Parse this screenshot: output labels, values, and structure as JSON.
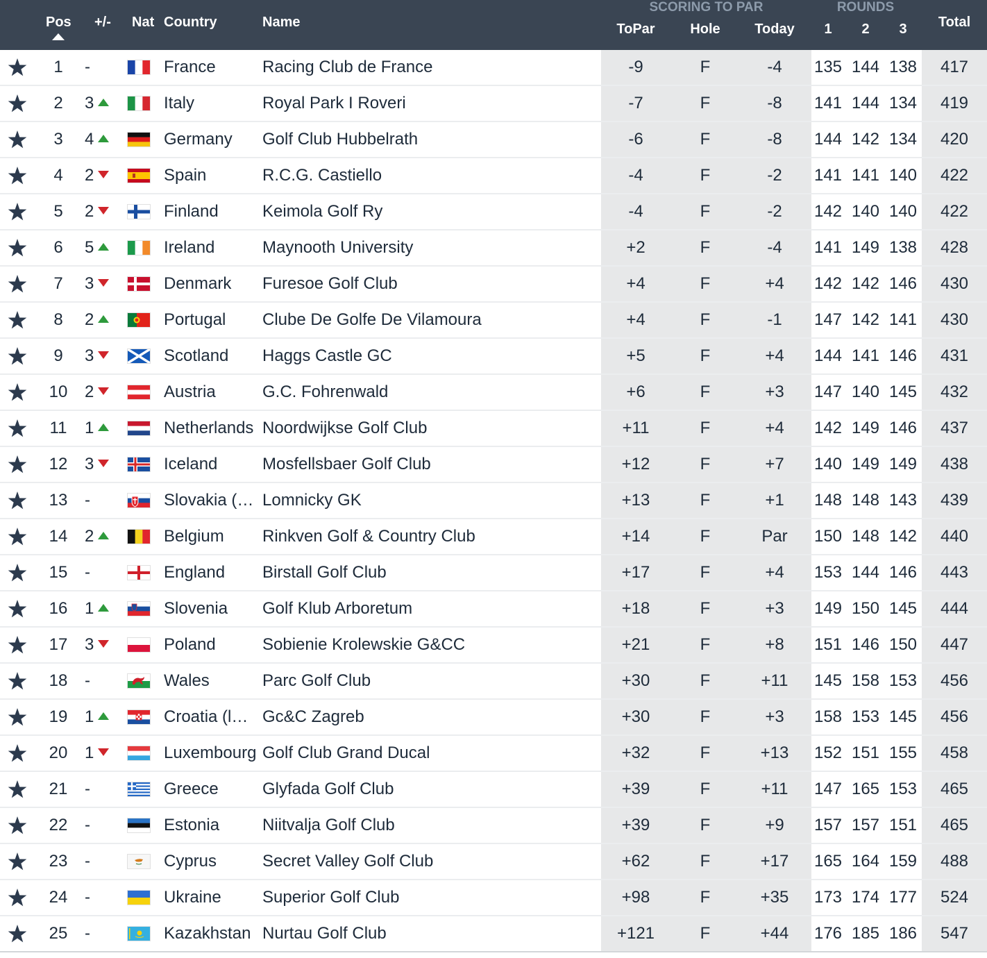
{
  "header": {
    "pos": "Pos",
    "change": "+/-",
    "nat": "Nat",
    "country": "Country",
    "name": "Name",
    "scoring_group": "SCORING TO PAR",
    "topar": "ToPar",
    "hole": "Hole",
    "today": "Today",
    "rounds_group": "ROUNDS",
    "r1": "1",
    "r2": "2",
    "r3": "3",
    "total": "Total"
  },
  "colors": {
    "header_bg": "#3a4553",
    "header_group_text": "#8d9bab",
    "shaded_column_bg": "#e7e8e9",
    "star": "#2c3a4d",
    "up": "#2e9a3c",
    "down": "#d0252b"
  },
  "icons": {
    "favorite": "star-icon",
    "move_up": "triangle-up-icon",
    "move_down": "triangle-down-icon",
    "sort": "sort-ascending-icon"
  },
  "rows": [
    {
      "pos": "1",
      "change": "-",
      "dir": "none",
      "flag": "france",
      "country": "France",
      "name": "Racing Club de France",
      "topar": "-9",
      "hole": "F",
      "today": "-4",
      "r1": "135",
      "r2": "144",
      "r3": "138",
      "total": "417"
    },
    {
      "pos": "2",
      "change": "3",
      "dir": "up",
      "flag": "italy",
      "country": "Italy",
      "name": "Royal Park I Roveri",
      "topar": "-7",
      "hole": "F",
      "today": "-8",
      "r1": "141",
      "r2": "144",
      "r3": "134",
      "total": "419"
    },
    {
      "pos": "3",
      "change": "4",
      "dir": "up",
      "flag": "germany",
      "country": "Germany",
      "name": "Golf Club Hubbelrath",
      "topar": "-6",
      "hole": "F",
      "today": "-8",
      "r1": "144",
      "r2": "142",
      "r3": "134",
      "total": "420"
    },
    {
      "pos": "4",
      "change": "2",
      "dir": "down",
      "flag": "spain",
      "country": "Spain",
      "name": "R.C.G. Castiello",
      "topar": "-4",
      "hole": "F",
      "today": "-2",
      "r1": "141",
      "r2": "141",
      "r3": "140",
      "total": "422"
    },
    {
      "pos": "5",
      "change": "2",
      "dir": "down",
      "flag": "finland",
      "country": "Finland",
      "name": "Keimola Golf Ry",
      "topar": "-4",
      "hole": "F",
      "today": "-2",
      "r1": "142",
      "r2": "140",
      "r3": "140",
      "total": "422"
    },
    {
      "pos": "6",
      "change": "5",
      "dir": "up",
      "flag": "ireland",
      "country": "Ireland",
      "name": "Maynooth University",
      "topar": "+2",
      "hole": "F",
      "today": "-4",
      "r1": "141",
      "r2": "149",
      "r3": "138",
      "total": "428"
    },
    {
      "pos": "7",
      "change": "3",
      "dir": "down",
      "flag": "denmark",
      "country": "Denmark",
      "name": "Furesoe Golf Club",
      "topar": "+4",
      "hole": "F",
      "today": "+4",
      "r1": "142",
      "r2": "142",
      "r3": "146",
      "total": "430"
    },
    {
      "pos": "8",
      "change": "2",
      "dir": "up",
      "flag": "portugal",
      "country": "Portugal",
      "name": "Clube De Golfe De Vilamoura",
      "topar": "+4",
      "hole": "F",
      "today": "-1",
      "r1": "147",
      "r2": "142",
      "r3": "141",
      "total": "430"
    },
    {
      "pos": "9",
      "change": "3",
      "dir": "down",
      "flag": "scotland",
      "country": "Scotland",
      "name": "Haggs Castle GC",
      "topar": "+5",
      "hole": "F",
      "today": "+4",
      "r1": "144",
      "r2": "141",
      "r3": "146",
      "total": "431"
    },
    {
      "pos": "10",
      "change": "2",
      "dir": "down",
      "flag": "austria",
      "country": "Austria",
      "name": "G.C. Fohrenwald",
      "topar": "+6",
      "hole": "F",
      "today": "+3",
      "r1": "147",
      "r2": "140",
      "r3": "145",
      "total": "432"
    },
    {
      "pos": "11",
      "change": "1",
      "dir": "up",
      "flag": "netherlands",
      "country": "Netherlands",
      "name": "Noordwijkse Golf Club",
      "topar": "+11",
      "hole": "F",
      "today": "+4",
      "r1": "142",
      "r2": "149",
      "r3": "146",
      "total": "437"
    },
    {
      "pos": "12",
      "change": "3",
      "dir": "down",
      "flag": "iceland",
      "country": "Iceland",
      "name": "Mosfellsbaer Golf Club",
      "topar": "+12",
      "hole": "F",
      "today": "+7",
      "r1": "140",
      "r2": "149",
      "r3": "149",
      "total": "438"
    },
    {
      "pos": "13",
      "change": "-",
      "dir": "none",
      "flag": "slovakia",
      "country": "Slovakia (…",
      "name": "Lomnicky GK",
      "topar": "+13",
      "hole": "F",
      "today": "+1",
      "r1": "148",
      "r2": "148",
      "r3": "143",
      "total": "439"
    },
    {
      "pos": "14",
      "change": "2",
      "dir": "up",
      "flag": "belgium",
      "country": "Belgium",
      "name": "Rinkven Golf & Country Club",
      "topar": "+14",
      "hole": "F",
      "today": "Par",
      "r1": "150",
      "r2": "148",
      "r3": "142",
      "total": "440"
    },
    {
      "pos": "15",
      "change": "-",
      "dir": "none",
      "flag": "england",
      "country": "England",
      "name": "Birstall Golf Club",
      "topar": "+17",
      "hole": "F",
      "today": "+4",
      "r1": "153",
      "r2": "144",
      "r3": "146",
      "total": "443"
    },
    {
      "pos": "16",
      "change": "1",
      "dir": "up",
      "flag": "slovenia",
      "country": "Slovenia",
      "name": "Golf Klub Arboretum",
      "topar": "+18",
      "hole": "F",
      "today": "+3",
      "r1": "149",
      "r2": "150",
      "r3": "145",
      "total": "444"
    },
    {
      "pos": "17",
      "change": "3",
      "dir": "down",
      "flag": "poland",
      "country": "Poland",
      "name": "Sobienie Krolewskie G&CC",
      "topar": "+21",
      "hole": "F",
      "today": "+8",
      "r1": "151",
      "r2": "146",
      "r3": "150",
      "total": "447"
    },
    {
      "pos": "18",
      "change": "-",
      "dir": "none",
      "flag": "wales",
      "country": "Wales",
      "name": "Parc Golf Club",
      "topar": "+30",
      "hole": "F",
      "today": "+11",
      "r1": "145",
      "r2": "158",
      "r3": "153",
      "total": "456"
    },
    {
      "pos": "19",
      "change": "1",
      "dir": "up",
      "flag": "croatia",
      "country": "Croatia (l…",
      "name": "Gc&C Zagreb",
      "topar": "+30",
      "hole": "F",
      "today": "+3",
      "r1": "158",
      "r2": "153",
      "r3": "145",
      "total": "456"
    },
    {
      "pos": "20",
      "change": "1",
      "dir": "down",
      "flag": "luxembourg",
      "country": "Luxembourg",
      "name": "Golf Club Grand Ducal",
      "topar": "+32",
      "hole": "F",
      "today": "+13",
      "r1": "152",
      "r2": "151",
      "r3": "155",
      "total": "458"
    },
    {
      "pos": "21",
      "change": "-",
      "dir": "none",
      "flag": "greece",
      "country": "Greece",
      "name": "Glyfada Golf Club",
      "topar": "+39",
      "hole": "F",
      "today": "+11",
      "r1": "147",
      "r2": "165",
      "r3": "153",
      "total": "465"
    },
    {
      "pos": "22",
      "change": "-",
      "dir": "none",
      "flag": "estonia",
      "country": "Estonia",
      "name": "Niitvalja Golf Club",
      "topar": "+39",
      "hole": "F",
      "today": "+9",
      "r1": "157",
      "r2": "157",
      "r3": "151",
      "total": "465"
    },
    {
      "pos": "23",
      "change": "-",
      "dir": "none",
      "flag": "cyprus",
      "country": "Cyprus",
      "name": "Secret Valley Golf Club",
      "topar": "+62",
      "hole": "F",
      "today": "+17",
      "r1": "165",
      "r2": "164",
      "r3": "159",
      "total": "488"
    },
    {
      "pos": "24",
      "change": "-",
      "dir": "none",
      "flag": "ukraine",
      "country": "Ukraine",
      "name": "Superior Golf Club",
      "topar": "+98",
      "hole": "F",
      "today": "+35",
      "r1": "173",
      "r2": "174",
      "r3": "177",
      "total": "524"
    },
    {
      "pos": "25",
      "change": "-",
      "dir": "none",
      "flag": "kazakhstan",
      "country": "Kazakhstan",
      "name": "Nurtau Golf Club",
      "topar": "+121",
      "hole": "F",
      "today": "+44",
      "r1": "176",
      "r2": "185",
      "r3": "186",
      "total": "547"
    }
  ]
}
